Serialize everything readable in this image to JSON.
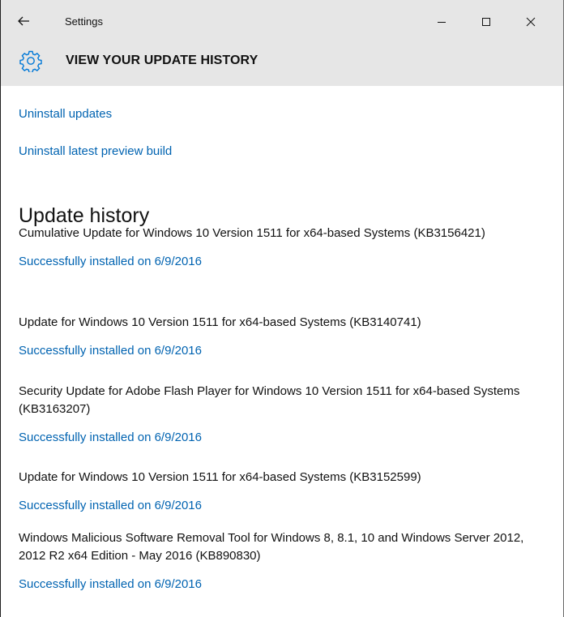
{
  "window": {
    "title": "Settings"
  },
  "header": {
    "title": "VIEW YOUR UPDATE HISTORY",
    "icon": "gear-icon"
  },
  "links": {
    "uninstall_updates": "Uninstall updates",
    "uninstall_preview": "Uninstall latest preview build"
  },
  "history": {
    "heading": "Update history",
    "items": [
      {
        "name": "Cumulative Update for Windows 10 Version 1511 for x64-based Systems (KB3156421)",
        "status": "Successfully installed on 6/9/2016"
      },
      {
        "name": "Update for Windows 10 Version 1511 for x64-based Systems (KB3140741)",
        "status": "Successfully installed on 6/9/2016"
      },
      {
        "name": "Security Update for Adobe Flash Player for Windows 10 Version 1511 for x64-based Systems (KB3163207)",
        "status": "Successfully installed on 6/9/2016"
      },
      {
        "name": "Update for Windows 10 Version 1511 for x64-based Systems (KB3152599)",
        "status": "Successfully installed on 6/9/2016"
      },
      {
        "name": "Windows Malicious Software Removal Tool for Windows 8, 8.1, 10 and Windows Server 2012, 2012 R2 x64 Edition - May 2016 (KB890830)",
        "status": "Successfully installed on 6/9/2016"
      }
    ]
  },
  "colors": {
    "chrome": "#e6e6e6",
    "link": "#0063b1",
    "accent_icon": "#0078d7"
  }
}
